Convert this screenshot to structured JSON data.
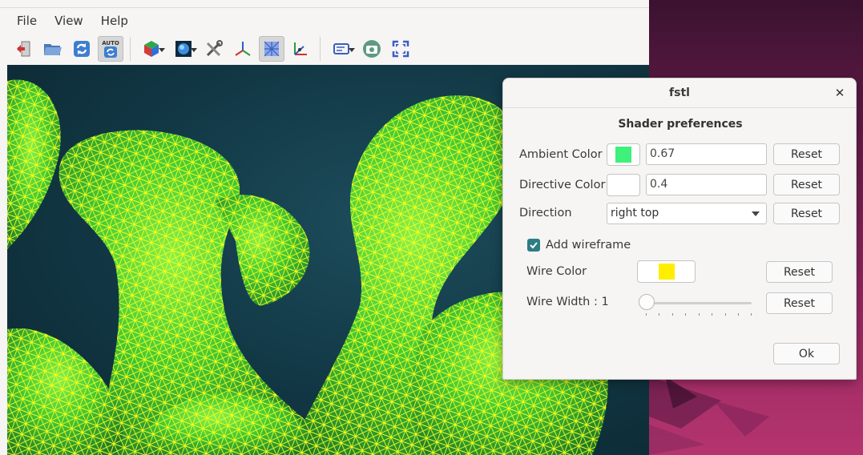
{
  "menubar": {
    "items": [
      "File",
      "View",
      "Help"
    ]
  },
  "toolbar": {
    "buttons": [
      {
        "icon": "exit-icon"
      },
      {
        "icon": "open-folder-icon"
      },
      {
        "icon": "reload-icon"
      },
      {
        "icon": "autoreload-icon",
        "label": "AUTO",
        "active": true
      },
      {
        "icon": "colored-cube-icon",
        "dropdown": true
      },
      {
        "icon": "shading-sphere-icon",
        "dropdown": true
      },
      {
        "icon": "tools-icon"
      },
      {
        "icon": "axes-icon"
      },
      {
        "icon": "wireframe-icon",
        "active": true
      },
      {
        "icon": "axes-view-icon"
      },
      {
        "icon": "projection-icon",
        "dropdown": true
      },
      {
        "icon": "camera-icon"
      },
      {
        "icon": "fullscreen-icon"
      }
    ]
  },
  "dialog": {
    "title": "fstl",
    "close_icon": "close-icon",
    "section_title": "Shader preferences",
    "ambient": {
      "label": "Ambient Color",
      "color": "#3ff07a",
      "value": "0.67",
      "reset": "Reset"
    },
    "directive": {
      "label": "Directive Color",
      "color": "#ffffff",
      "value": "0.4",
      "reset": "Reset"
    },
    "direction": {
      "label": "Direction",
      "selected": "right top",
      "reset": "Reset"
    },
    "wireframe": {
      "label": "Add wireframe",
      "checked": true
    },
    "wire_color": {
      "label": "Wire Color",
      "color": "#ffee00",
      "reset": "Reset"
    },
    "wire_width": {
      "label": "Wire Width : 1",
      "value": 1,
      "reset": "Reset"
    },
    "ok": "Ok"
  },
  "colors": {
    "accent": "#2d7d83",
    "mesh_fill": "#3fd33c",
    "mesh_wire": "#f2ff1c",
    "viewport_bg": "#123845"
  }
}
